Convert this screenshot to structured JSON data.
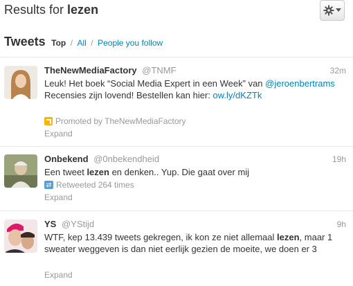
{
  "header": {
    "results_prefix": "Results for",
    "query": "lezen",
    "gear_icon": "gear-icon",
    "caret_icon": "caret-down-icon"
  },
  "tabs": {
    "label": "Tweets",
    "items": [
      {
        "label": "Top",
        "active": true
      },
      {
        "label": "All",
        "active": false
      },
      {
        "label": "People you follow",
        "active": false
      }
    ],
    "separator": "/"
  },
  "tweets": [
    {
      "name": "TheNewMediaFactory",
      "handle": "@TNMF",
      "time": "32m",
      "text_parts": [
        "Leuk! Het boek “Social Media Expert in een Week” van ",
        "@jeroenbertrams",
        " Recensies zijn lovend! Bestellen kan hier: ",
        "ow.ly/dKZTk"
      ],
      "meta_icon": "promoted-icon",
      "meta": "Promoted by TheNewMediaFactory",
      "expand": "Expand"
    },
    {
      "name": "Onbekend",
      "handle": "@0nbekendheid",
      "time": "19h",
      "text_parts": [
        "Een tweet ",
        "lezen",
        " en denken.. Yup. Die gaat over mij"
      ],
      "meta_icon": "retweet-icon",
      "meta": "Retweeted 264 times",
      "expand": "Expand"
    },
    {
      "name": "YS",
      "handle": "@YStijd",
      "time": "9h",
      "text_parts": [
        "WTF, kep 13.439 tweets gekregen, ik kon ze niet allemaal ",
        "lezen",
        ", maar 1 sweater weggeven is dan niet eerlijk gezien de moeite, we doen er 3"
      ],
      "expand": "Expand"
    }
  ],
  "colors": {
    "link": "#0084b4",
    "muted": "#999999",
    "text": "#333333",
    "promoted": "#ffb300",
    "retweet": "#5c9ed6"
  }
}
